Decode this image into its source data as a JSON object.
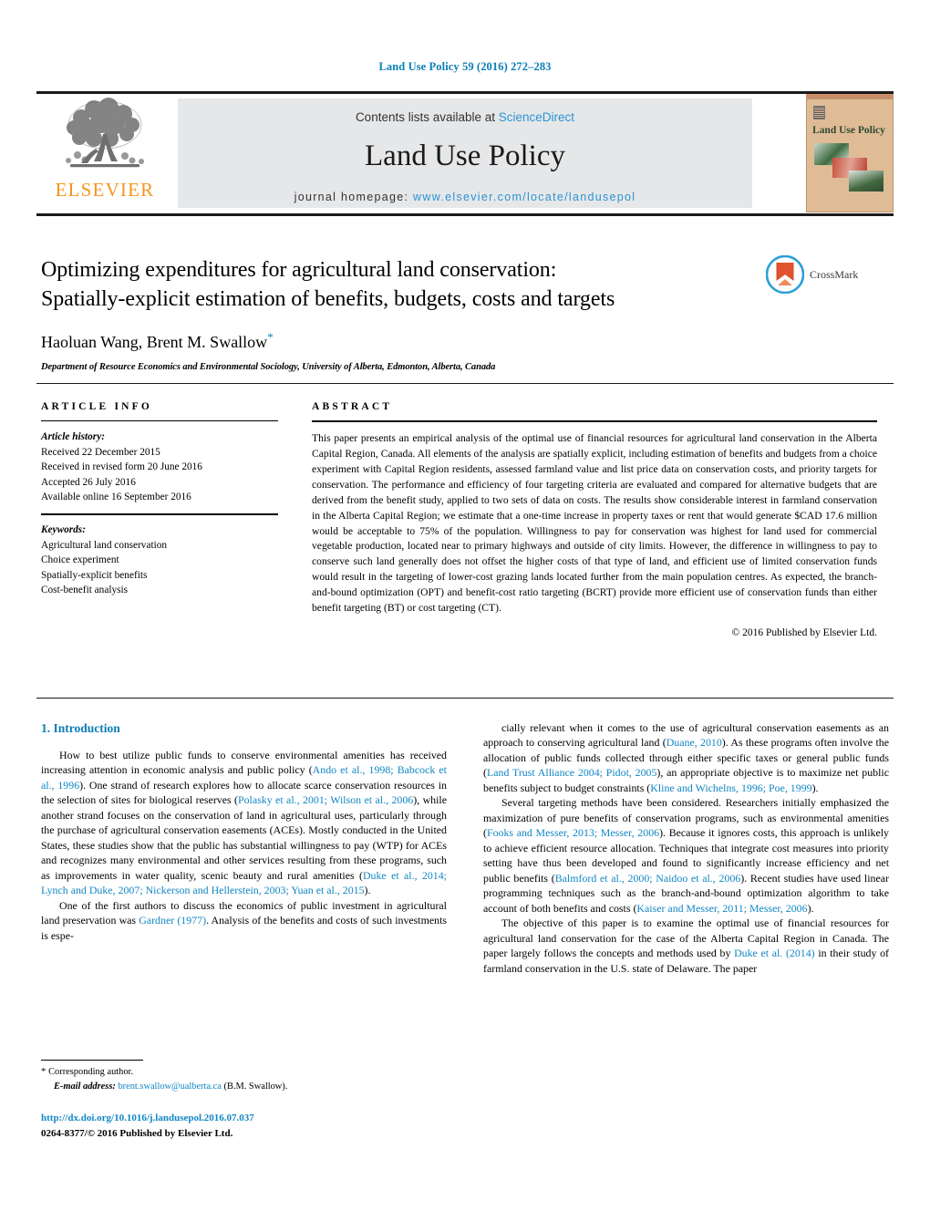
{
  "running_head": "Land Use Policy 59 (2016) 272–283",
  "masthead": {
    "publisher_name": "ELSEVIER",
    "contents_prefix": "Contents lists available at ",
    "contents_link": "ScienceDirect",
    "journal_title": "Land Use Policy",
    "homepage_prefix": "journal homepage: ",
    "homepage_url": "www.elsevier.com/locate/landusepol",
    "cover_title": "Land Use Policy"
  },
  "article": {
    "title_line1": "Optimizing expenditures for agricultural land conservation:",
    "title_line2": "Spatially-explicit estimation of benefits, budgets, costs and targets",
    "authors": "Haoluan Wang, Brent M. Swallow",
    "corresponding_marker": "*",
    "affiliation": "Department of Resource Economics and Environmental Sociology, University of Alberta, Edmonton, Alberta, Canada",
    "crossmark_label": "CrossMark"
  },
  "article_info": {
    "heading": "ARTICLE INFO",
    "history_label": "Article history:",
    "history": [
      "Received 22 December 2015",
      "Received in revised form 20 June 2016",
      "Accepted 26 July 2016",
      "Available online 16 September 2016"
    ],
    "keywords_label": "Keywords:",
    "keywords": [
      "Agricultural land conservation",
      "Choice experiment",
      "Spatially-explicit benefits",
      "Cost-benefit analysis"
    ]
  },
  "abstract": {
    "heading": "ABSTRACT",
    "text": "This paper presents an empirical analysis of the optimal use of financial resources for agricultural land conservation in the Alberta Capital Region, Canada. All elements of the analysis are spatially explicit, including estimation of benefits and budgets from a choice experiment with Capital Region residents, assessed farmland value and list price data on conservation costs, and priority targets for conservation. The performance and efficiency of four targeting criteria are evaluated and compared for alternative budgets that are derived from the benefit study, applied to two sets of data on costs. The results show considerable interest in farmland conservation in the Alberta Capital Region; we estimate that a one-time increase in property taxes or rent that would generate $CAD 17.6 million would be acceptable to 75% of the population. Willingness to pay for conservation was highest for land used for commercial vegetable production, located near to primary highways and outside of city limits. However, the difference in willingness to pay to conserve such land generally does not offset the higher costs of that type of land, and efficient use of limited conservation funds would result in the targeting of lower-cost grazing lands located further from the main population centres. As expected, the branch-and-bound optimization (OPT) and benefit-cost ratio targeting (BCRT) provide more efficient use of conservation funds than either benefit targeting (BT) or cost targeting (CT).",
    "copyright": "© 2016 Published by Elsevier Ltd."
  },
  "introduction": {
    "section_number_title": "1. Introduction",
    "left_paragraphs": [
      {
        "segments": [
          {
            "t": "How to best utilize public funds to conserve environmental amenities has received increasing attention in economic analysis and public policy (",
            "ref": false
          },
          {
            "t": "Ando et al., 1998; Babcock et al., 1996",
            "ref": true
          },
          {
            "t": "). One strand of research explores how to allocate scarce conservation resources in the selection of sites for biological reserves (",
            "ref": false
          },
          {
            "t": "Polasky et al., 2001; Wilson et al., 2006",
            "ref": true
          },
          {
            "t": "), while another strand focuses on the conservation of land in agricultural uses, particularly through the purchase of agricultural conservation easements (ACEs). Mostly conducted in the United States, these studies show that the public has substantial willingness to pay (WTP) for ACEs and recognizes many environmental and other services resulting from these programs, such as improvements in water quality, scenic beauty and rural amenities (",
            "ref": false
          },
          {
            "t": "Duke et al., 2014; Lynch and Duke, 2007; Nickerson and Hellerstein, 2003; Yuan et al., 2015",
            "ref": true
          },
          {
            "t": ").",
            "ref": false
          }
        ]
      },
      {
        "segments": [
          {
            "t": "One of the first authors to discuss the economics of public investment in agricultural land preservation was ",
            "ref": false
          },
          {
            "t": "Gardner (1977)",
            "ref": true
          },
          {
            "t": ". Analysis of the benefits and costs of such investments is espe-",
            "ref": false
          }
        ]
      }
    ],
    "right_paragraphs": [
      {
        "segments": [
          {
            "t": "cially relevant when it comes to the use of agricultural conservation easements as an approach to conserving agricultural land (",
            "ref": false
          },
          {
            "t": "Duane, 2010",
            "ref": true
          },
          {
            "t": "). As these programs often involve the allocation of public funds collected through either specific taxes or general public funds (",
            "ref": false
          },
          {
            "t": "Land Trust Alliance 2004; Pidot, 2005",
            "ref": true
          },
          {
            "t": "), an appropriate objective is to maximize net public benefits subject to budget constraints (",
            "ref": false
          },
          {
            "t": "Kline and Wichelns, 1996; Poe, 1999",
            "ref": true
          },
          {
            "t": ").",
            "ref": false
          }
        ]
      },
      {
        "segments": [
          {
            "t": "Several targeting methods have been considered. Researchers initially emphasized the maximization of pure benefits of conservation programs, such as environmental amenities (",
            "ref": false
          },
          {
            "t": "Fooks and Messer, 2013; Messer, 2006",
            "ref": true
          },
          {
            "t": "). Because it ignores costs, this approach is unlikely to achieve efficient resource allocation. Techniques that integrate cost measures into priority setting have thus been developed and found to significantly increase efficiency and net public benefits (",
            "ref": false
          },
          {
            "t": "Balmford et al., 2000; Naidoo et al., 2006",
            "ref": true
          },
          {
            "t": "). Recent studies have used linear programming techniques such as the branch-and-bound optimization algorithm to take account of both benefits and costs (",
            "ref": false
          },
          {
            "t": "Kaiser and Messer, 2011; Messer, 2006",
            "ref": true
          },
          {
            "t": ").",
            "ref": false
          }
        ]
      },
      {
        "segments": [
          {
            "t": "The objective of this paper is to examine the optimal use of financial resources for agricultural land conservation for the case of the Alberta Capital Region in Canada. The paper largely follows the concepts and methods used by ",
            "ref": false
          },
          {
            "t": "Duke et al. (2014)",
            "ref": true
          },
          {
            "t": " in their study of farmland conservation in the U.S. state of Delaware. The paper",
            "ref": false
          }
        ]
      }
    ]
  },
  "footnote": {
    "asterisk": "*",
    "corresponding_author": "Corresponding author.",
    "email_label": "E-mail address:",
    "email": "brent.swallow@ualberta.ca",
    "email_owner": "(B.M. Swallow)."
  },
  "footer": {
    "doi": "http://dx.doi.org/10.1016/j.landusepol.2016.07.037",
    "issn_line": "0264-8377/© 2016 Published by Elsevier Ltd."
  },
  "colors": {
    "link_blue": "#1187c4",
    "running_head_blue": "#0b7eb5",
    "sciencedirect_blue": "#2a94d6",
    "elsevier_orange": "#F7941E",
    "band_grey": "#e6e7e8",
    "cover_tan": "#dfbb96"
  }
}
